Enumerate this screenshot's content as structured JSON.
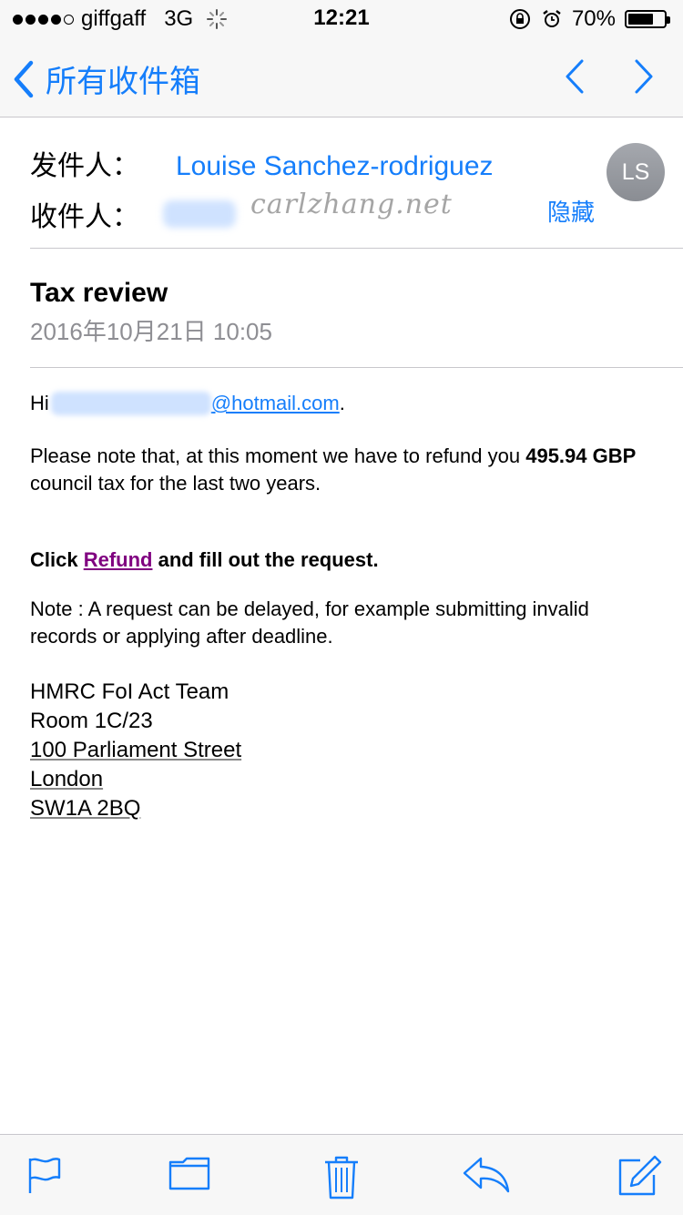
{
  "status_bar": {
    "carrier": "giffgaff",
    "network": "3G",
    "time": "12:21",
    "battery_percent": "70%",
    "battery_level": 0.7
  },
  "nav": {
    "back_label": "所有收件箱"
  },
  "header": {
    "from_label": "发件人：",
    "sender_name": "Louise Sanchez-rodriguez",
    "to_label": "收件人：",
    "hide_label": "隐藏",
    "avatar_initials": "LS",
    "watermark": "carlzhang.net"
  },
  "message": {
    "subject": "Tax review",
    "date": "2016年10月21日 10:05",
    "greeting_prefix": "Hi ",
    "email_domain": "@hotmail.com",
    "greeting_suffix": ".",
    "para1_a": "Please note that, at this moment we have to refund you ",
    "para1_bold": "495.94 GBP",
    "para1_b": " council tax for the last two years.",
    "para2_a": "Click ",
    "para2_link": "Refund",
    "para2_b": " and fill out the request.",
    "para3": "Note : A request can be delayed, for example submitting invalid records or applying after deadline.",
    "address_line1": "HMRC FoI Act Team",
    "address_line2": "Room 1C/23",
    "address_line3": "100 Parliament Street",
    "address_line4": "London",
    "address_line5": "SW1A 2BQ"
  },
  "colors": {
    "accent": "#157efb",
    "visited_link": "#800080",
    "secondary_text": "#8e8e93",
    "bar_background": "#f7f7f7"
  },
  "toolbar": {
    "icons": [
      "flag-icon",
      "folder-icon",
      "trash-icon",
      "reply-icon",
      "compose-icon"
    ]
  }
}
